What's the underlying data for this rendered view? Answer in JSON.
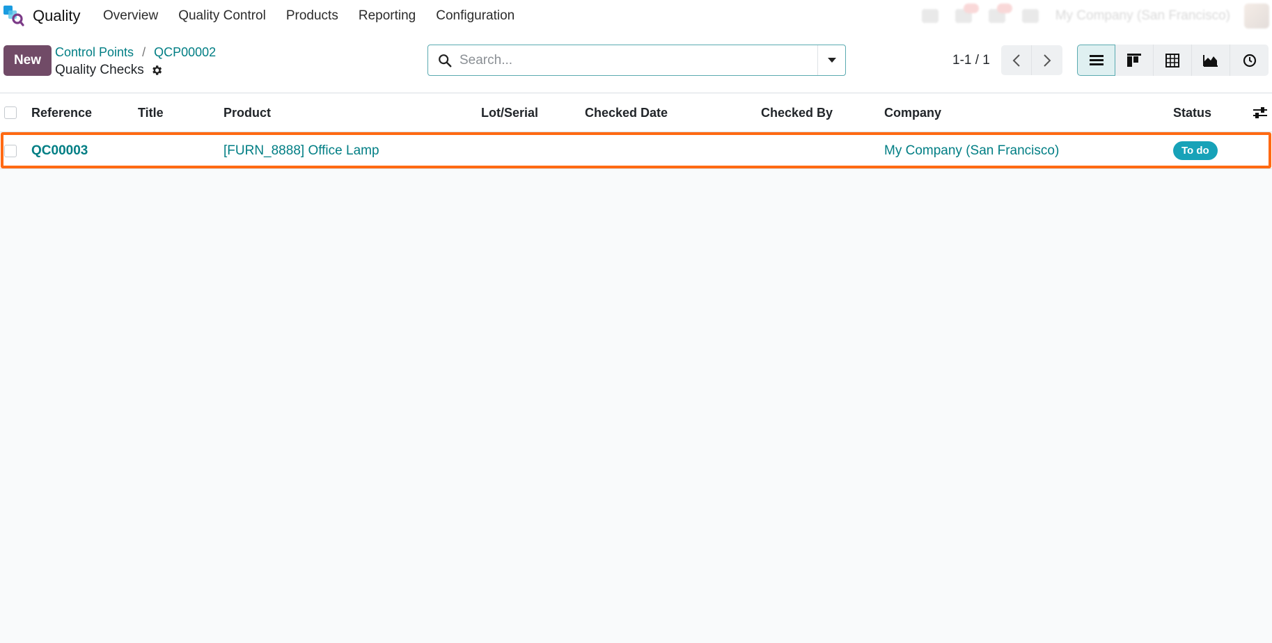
{
  "navbar": {
    "app_name": "Quality",
    "menu": [
      "Overview",
      "Quality Control",
      "Products",
      "Reporting",
      "Configuration"
    ],
    "company": "My Company (San Francisco)"
  },
  "control": {
    "new_label": "New",
    "breadcrumb": [
      "Control Points",
      "QCP00002"
    ],
    "breadcrumb_sep": "/",
    "title": "Quality Checks",
    "search_placeholder": "Search...",
    "pager": "1-1 / 1"
  },
  "list": {
    "columns": [
      "Reference",
      "Title",
      "Product",
      "Lot/Serial",
      "Checked Date",
      "Checked By",
      "Company",
      "Status"
    ],
    "rows": [
      {
        "reference": "QC00003",
        "title": "",
        "product": "[FURN_8888] Office Lamp",
        "lot": "",
        "checked_date": "",
        "checked_by": "",
        "company": "My Company (San Francisco)",
        "status": "To do"
      }
    ]
  },
  "colors": {
    "brand": "#714b67",
    "link": "#017e84",
    "status_todo": "#17a2b8",
    "highlight": "#ff6a13"
  }
}
